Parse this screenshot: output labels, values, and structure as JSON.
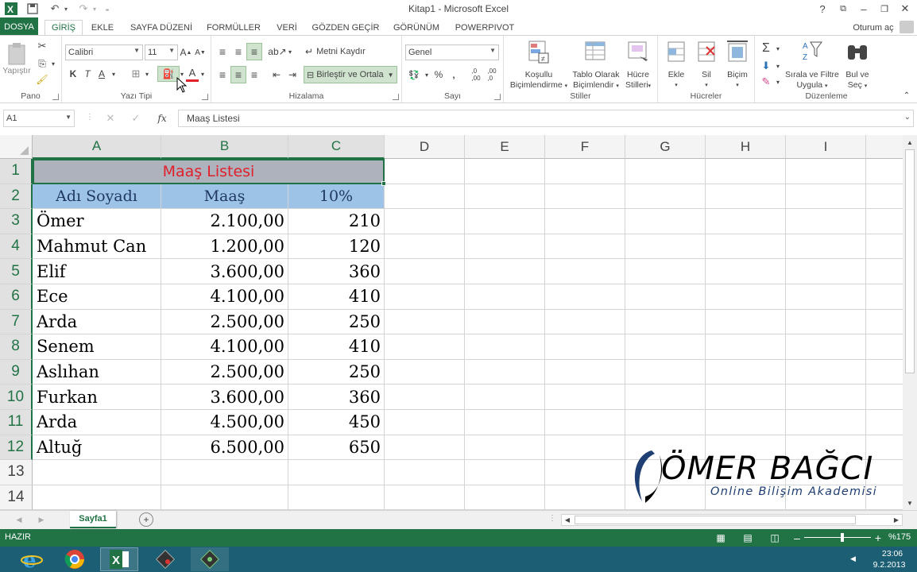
{
  "window": {
    "title": "Kitap1 - Microsoft Excel",
    "user": "Oturum aç"
  },
  "tabs": [
    "DOSYA",
    "GİRİŞ",
    "EKLE",
    "SAYFA DÜZENİ",
    "FORMÜLLER",
    "VERİ",
    "GÖZDEN GEÇİR",
    "GÖRÜNÜM",
    "POWERPIVOT"
  ],
  "active_tab": "GİRİŞ",
  "ribbon": {
    "pano": {
      "label": "Pano",
      "paste": "Yapıştır"
    },
    "font": {
      "label": "Yazı Tipi",
      "name": "Calibri",
      "size": "11",
      "bold": "K",
      "italic": "T",
      "underline": "A"
    },
    "align": {
      "label": "Hizalama",
      "wrap": "Metni Kaydır",
      "merge": "Birleştir ve Ortala"
    },
    "number": {
      "label": "Sayı",
      "format": "Genel",
      "percent": "%",
      "comma": "‚"
    },
    "styles": {
      "label": "Stiller",
      "cond1": "Koşullu",
      "cond2": "Biçimlendirme",
      "table1": "Tablo Olarak",
      "table2": "Biçimlendir",
      "cell1": "Hücre",
      "cell2": "Stilleri"
    },
    "cells": {
      "label": "Hücreler",
      "insert": "Ekle",
      "delete": "Sil",
      "format": "Biçim"
    },
    "edit": {
      "label": "Düzenleme",
      "sort1": "Sırala ve Filtre",
      "sort2": "Uygula",
      "find1": "Bul ve",
      "find2": "Seç"
    }
  },
  "formula_bar": {
    "name_box": "A1",
    "content": "Maaş Listesi",
    "fx": "fx"
  },
  "columns": [
    "A",
    "B",
    "C",
    "D",
    "E",
    "F",
    "G",
    "H",
    "I"
  ],
  "rows": [
    "1",
    "2",
    "3",
    "4",
    "5",
    "6",
    "7",
    "8",
    "9",
    "10",
    "11",
    "12",
    "13",
    "14"
  ],
  "sheet": {
    "title": "Maaş Listesi",
    "headers": [
      "Adı Soyadı",
      "Maaş",
      "10%"
    ],
    "data": [
      [
        "Ömer",
        "2.100,00",
        "210"
      ],
      [
        "Mahmut Can",
        "1.200,00",
        "120"
      ],
      [
        "Elif",
        "3.600,00",
        "360"
      ],
      [
        "Ece",
        "4.100,00",
        "410"
      ],
      [
        "Arda",
        "2.500,00",
        "250"
      ],
      [
        "Senem",
        "4.100,00",
        "410"
      ],
      [
        "Aslıhan",
        "2.500,00",
        "250"
      ],
      [
        "Furkan",
        "3.600,00",
        "360"
      ],
      [
        "Arda",
        "4.500,00",
        "450"
      ],
      [
        "Altuğ",
        "6.500,00",
        "650"
      ]
    ],
    "colors": {
      "title_bg": "#aeb2bd",
      "title_text": "#e0202a",
      "header_bg": "#9dc3e6",
      "accent": "#217346"
    }
  },
  "sheet_tab": "Sayfa1",
  "status": {
    "ready": "HAZIR",
    "zoom": "%175"
  },
  "clock": {
    "time": "23:06",
    "date": "9.2.2013"
  },
  "logo": {
    "name": "ÖMER BAĞCI",
    "subtitle": "Online Bilişim Akademisi"
  },
  "icons": [
    "excel-icon",
    "save-icon",
    "undo-icon",
    "redo-icon",
    "help-icon",
    "restore-icon",
    "minimize-icon",
    "maximize-icon",
    "close-icon",
    "ie-icon",
    "chrome-icon",
    "excel-taskbar-icon",
    "app-icon",
    "app2-icon"
  ]
}
